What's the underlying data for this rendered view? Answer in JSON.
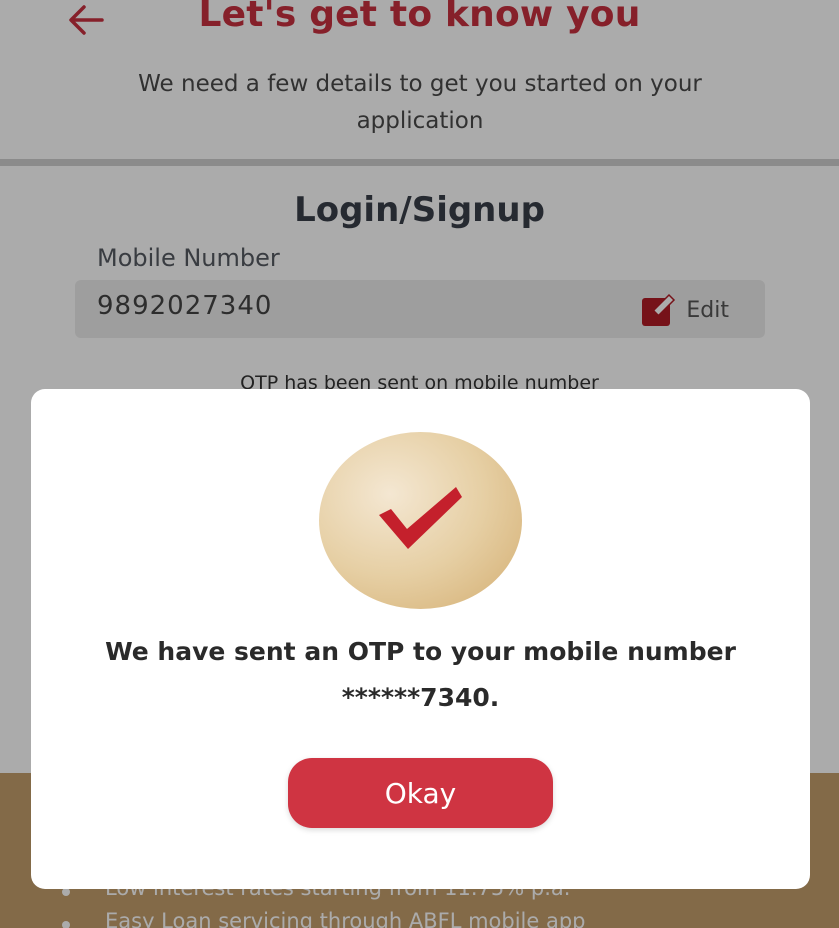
{
  "header": {
    "title": "Let's get to know you",
    "subtitle": "We need a few details to get you started on your application"
  },
  "form": {
    "title": "Login/Signup",
    "mobile_label": "Mobile Number",
    "mobile_value": "9892027340",
    "edit_label": "Edit",
    "otp_sent_text": "OTP has been sent on mobile number"
  },
  "banner": {
    "features": [
      "Low interest rates starting from 11.75% p.a.",
      "Easy Loan servicing through ABFL mobile app"
    ]
  },
  "modal": {
    "message_line1": "We have sent an OTP to your mobile number",
    "message_line2": "******7340.",
    "okay_label": "Okay"
  },
  "colors": {
    "brand_red": "#c8313f",
    "button_red": "#cf3442",
    "banner_gold": "#c49e6c"
  },
  "icons": {
    "back": "back-arrow-icon",
    "edit": "edit-icon",
    "success": "checkmark-icon"
  }
}
